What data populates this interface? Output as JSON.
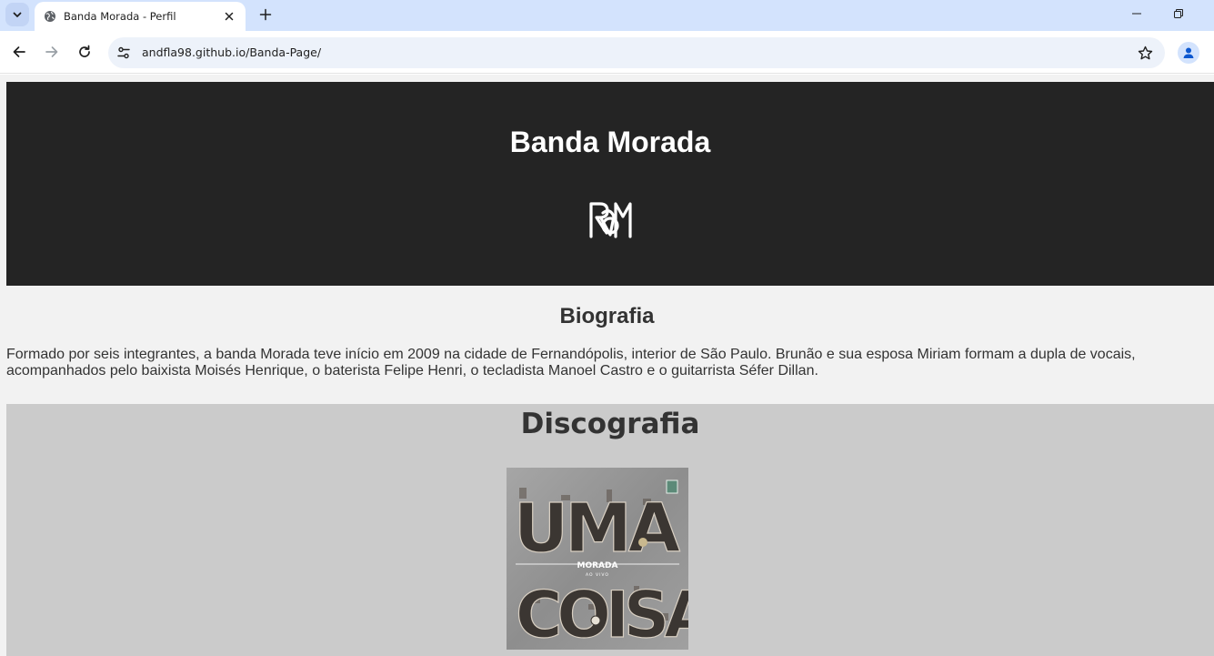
{
  "browser": {
    "tab_title": "Banda Morada - Perfil",
    "url": "andfla98.github.io/Banda-Page/"
  },
  "page": {
    "hero": {
      "title": "Banda Morada",
      "logo_icon": "morada-logo-icon"
    },
    "bio": {
      "title": "Biografia",
      "text": "Formado por seis integrantes, a banda Morada teve início em 2009 na cidade de Fernandópolis, interior de São Paulo. Brunão e sua esposa Miriam formam a dupla de vocais, acompanhados pelo baixista Moisés Henrique, o baterista Felipe Henri, o tecladista Manoel Castro e o guitarrista Séfer Dillan."
    },
    "discography": {
      "title": "Discografia",
      "album_cover_text": {
        "top": "UMA",
        "band": "MORADA",
        "sub": "AO VIVO",
        "bottom": "COISA"
      }
    }
  },
  "colors": {
    "tabstrip": "#d3e3fd",
    "omnibox": "#edf2fa",
    "hero_bg": "#242424",
    "page_bg": "#f2f2f2",
    "disco_bg": "#cbcbcb",
    "text": "#333333"
  }
}
